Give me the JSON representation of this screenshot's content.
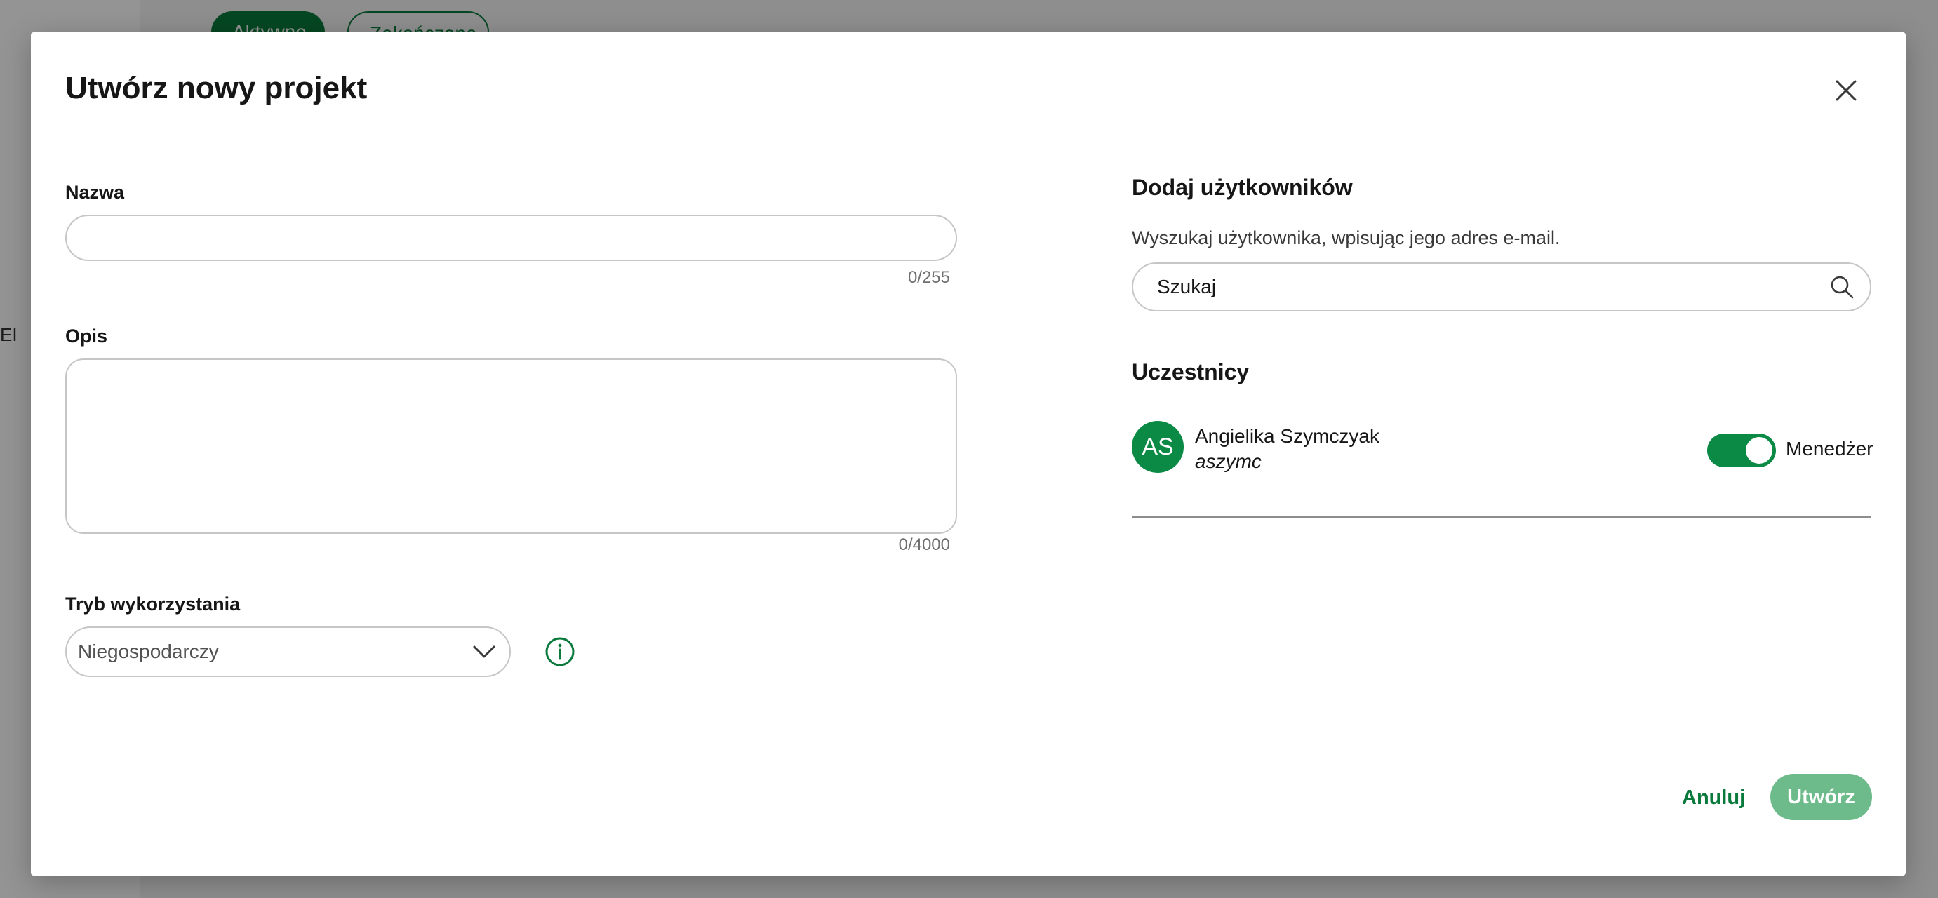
{
  "background": {
    "chip_active": "Aktywne",
    "chip_inactive": "Zakończone",
    "side_text": "EI"
  },
  "modal": {
    "title": "Utwórz nowy projekt",
    "close_icon": "close-icon"
  },
  "form": {
    "name": {
      "label": "Nazwa",
      "value": "",
      "counter": "0/255"
    },
    "description": {
      "label": "Opis",
      "value": "",
      "counter": "0/4000"
    },
    "usage_mode": {
      "label": "Tryb wykorzystania",
      "selected": "Niegospodarczy",
      "icon": "chevron-down-icon",
      "info_icon": "info-icon"
    }
  },
  "users": {
    "title": "Dodaj użytkowników",
    "helper": "Wyszukaj użytkownika, wpisując jego adres e-mail.",
    "search_placeholder": "Szukaj",
    "search_icon": "search-icon"
  },
  "participants": {
    "title": "Uczestnicy",
    "items": [
      {
        "initials": "AS",
        "name": "Angielika Szymczyak",
        "login": "aszymc",
        "manager_label": "Menedżer",
        "manager_on": true
      }
    ]
  },
  "footer": {
    "cancel_label": "Anuluj",
    "create_label": "Utwórz"
  },
  "colors": {
    "accent": "#0a7a3c",
    "avatar": "#0a8a45",
    "create_disabled": "#6dbb8b"
  }
}
